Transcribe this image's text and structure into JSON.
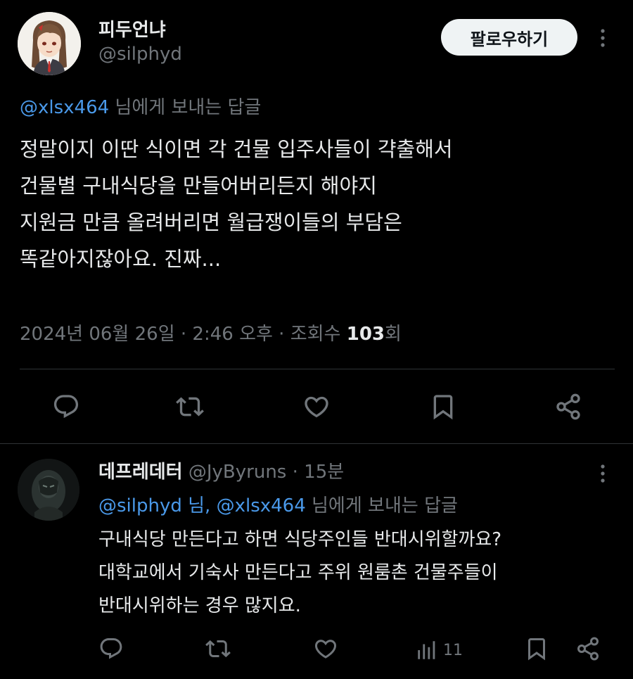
{
  "post": {
    "author_name": "피두언냐",
    "author_handle": "@silphyd",
    "follow_label": "팔로우하기",
    "reply_to_handle": "@xlsx464",
    "reply_to_suffix": " 님에게 보내는 답글",
    "text_lines": [
      "정말이지 이딴 식이면 각 건물 입주사들이 갹출해서",
      "건물별 구내식당을 만들어버리든지 해야지",
      "지원금 만큼 올려버리면 월급쟁이들의 부담은",
      "똑같아지잖아요. 진짜..."
    ],
    "meta_datetime": "2024년 06월 26일 · 2:46 오후 · 조회수 ",
    "meta_views": "103",
    "meta_views_suffix": "회",
    "icons": [
      "reply-icon",
      "retweet-icon",
      "like-icon",
      "bookmark-icon",
      "share-icon"
    ]
  },
  "reply": {
    "author_name": "데프레데터",
    "author_handle": " @JyByruns",
    "time": " · 15분",
    "reply_to_handles": "@silphyd 님, @xlsx464",
    "reply_to_suffix": " 님에게 보내는 답글",
    "text_lines": [
      "구내식당 만든다고 하면 식당주인들 반대시위할까요?",
      "대학교에서 기숙사 만든다고 주위 원룸촌 건물주들이",
      "반대시위하는 경우 많지요."
    ],
    "views_count": "11",
    "icons": [
      "reply-icon",
      "retweet-icon",
      "like-icon",
      "views-icon",
      "bookmark-icon",
      "share-icon"
    ]
  },
  "colors": {
    "background": "#000000",
    "text": "#e7e9ea",
    "secondary": "#71767b",
    "link": "#4a99e9",
    "divider": "#2f3336"
  }
}
